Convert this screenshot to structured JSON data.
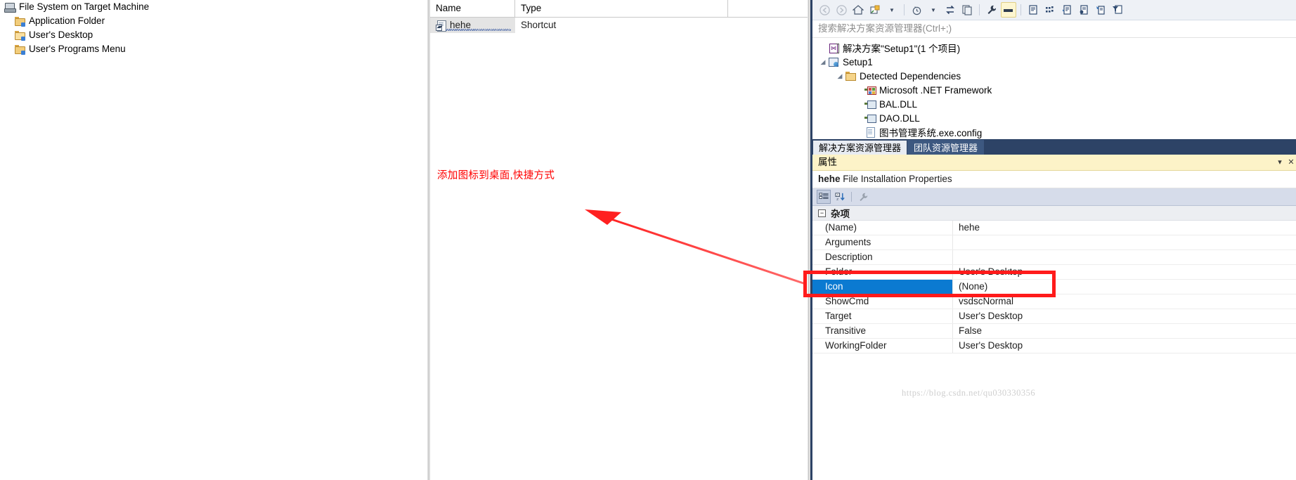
{
  "file_system_pane": {
    "title": "File System on Target Machine",
    "nodes": [
      {
        "label": "File System on Target Machine",
        "icon": "computer-icon",
        "level": 0
      },
      {
        "label": "Application Folder",
        "icon": "folder-icon",
        "level": 1
      },
      {
        "label": "User's Desktop",
        "icon": "folder-open-icon",
        "level": 1
      },
      {
        "label": "User's Programs Menu",
        "icon": "folder-icon",
        "level": 1
      }
    ]
  },
  "list_pane": {
    "columns": [
      "Name",
      "Type"
    ],
    "rows": [
      {
        "name": "hehe",
        "type": "Shortcut",
        "icon": "shortcut-icon",
        "selected": true,
        "misspelled": true
      }
    ]
  },
  "annotation": {
    "text": "添加图标到桌面,快捷方式",
    "color": "#ff0000",
    "arrow_color": "#ff2020"
  },
  "solution_explorer": {
    "toolbar": [
      {
        "name": "back-icon",
        "glyph": "←"
      },
      {
        "name": "forward-icon",
        "glyph": "→"
      },
      {
        "name": "home-icon",
        "glyph": "⌂"
      },
      {
        "name": "new-folder-icon",
        "glyph": "▣"
      },
      {
        "name": "new-folder-dropdown-icon",
        "glyph": "▾"
      },
      {
        "name": "pending-changes-icon",
        "glyph": "◷"
      },
      {
        "name": "pending-changes-dropdown-icon",
        "glyph": "▾"
      },
      {
        "name": "sync-icon",
        "glyph": "⇆"
      },
      {
        "name": "collapse-all-icon",
        "glyph": "▤"
      },
      {
        "name": "properties-wrench-icon",
        "glyph": "🔧"
      },
      {
        "name": "preview-selected-items-icon",
        "glyph": "▬"
      },
      {
        "name": "show-all-files-icon",
        "glyph": "▤"
      },
      {
        "name": "refresh-icon",
        "glyph": "⣿"
      },
      {
        "name": "view-code-icon",
        "glyph": "▤"
      },
      {
        "name": "view-designer-icon",
        "glyph": "▥"
      },
      {
        "name": "file-editor-icon",
        "glyph": "▤"
      },
      {
        "name": "filter-icon",
        "glyph": "▼"
      }
    ],
    "search_placeholder": "搜索解决方案资源管理器(Ctrl+;)",
    "tree": [
      {
        "label": "解决方案\"Setup1\"(1 个项目)",
        "icon": "solution-icon",
        "level": 0,
        "expander": ""
      },
      {
        "label": "Setup1",
        "icon": "setup-project-icon",
        "level": 1,
        "expander": "◢"
      },
      {
        "label": "Detected Dependencies",
        "icon": "folder-icon",
        "level": 2,
        "expander": "◢"
      },
      {
        "label": "Microsoft .NET Framework",
        "icon": "assembly-net-icon",
        "level": 3,
        "expander": ""
      },
      {
        "label": "BAL.DLL",
        "icon": "assembly-icon",
        "level": 3,
        "expander": ""
      },
      {
        "label": "DAO.DLL",
        "icon": "assembly-icon",
        "level": 3,
        "expander": ""
      },
      {
        "label": "图书管理系统.exe.config",
        "icon": "config-file-icon",
        "level": 3,
        "expander": ""
      }
    ],
    "tabs": [
      {
        "label": "解决方案资源管理器",
        "active": true
      },
      {
        "label": "团队资源管理器",
        "active": false
      }
    ]
  },
  "properties": {
    "title": "属性",
    "title_buttons": [
      {
        "name": "properties-dropdown-icon",
        "glyph": "▾"
      },
      {
        "name": "properties-close-icon",
        "glyph": "✕"
      }
    ],
    "object_name": "hehe",
    "object_type": "File Installation Properties",
    "toolbar": [
      {
        "name": "categorized-view-icon",
        "glyph": "▦",
        "pressed": true
      },
      {
        "name": "alphabetical-sort-icon",
        "glyph": "⇵",
        "pressed": false
      },
      {
        "name": "property-pages-icon",
        "glyph": "🔧",
        "pressed": false
      }
    ],
    "category": "杂项",
    "category_expanded": true,
    "rows": [
      {
        "name": "(Name)",
        "value": "hehe",
        "selected": false
      },
      {
        "name": "Arguments",
        "value": "",
        "selected": false
      },
      {
        "name": "Description",
        "value": "",
        "selected": false
      },
      {
        "name": "Folder",
        "value": "User's Desktop",
        "selected": false
      },
      {
        "name": "Icon",
        "value": "(None)",
        "selected": true
      },
      {
        "name": "ShowCmd",
        "value": "vsdscNormal",
        "selected": false
      },
      {
        "name": "Target",
        "value": "User's Desktop",
        "selected": false
      },
      {
        "name": "Transitive",
        "value": "False",
        "selected": false
      },
      {
        "name": "WorkingFolder",
        "value": "User's Desktop",
        "selected": false
      }
    ],
    "highlight_color": "#ff1b1b"
  },
  "watermark": {
    "text": "https://blog.csdn.net/qu030330356"
  }
}
